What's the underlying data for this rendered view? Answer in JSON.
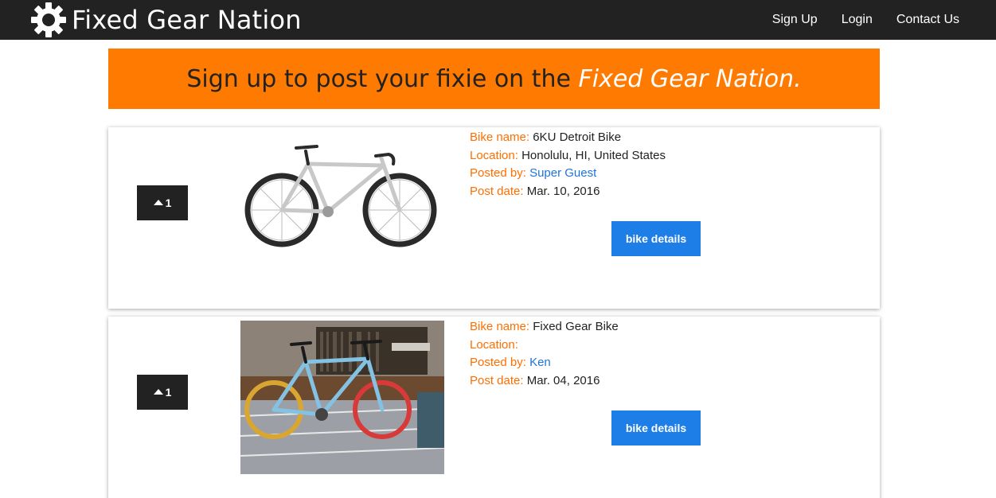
{
  "navbar": {
    "brand": "Fixed Gear Nation",
    "links": [
      "Sign Up",
      "Login",
      "Contact Us"
    ]
  },
  "banner": {
    "prefix": "Sign up to post your fixie on the ",
    "emphasis": "Fixed Gear Nation."
  },
  "labels": {
    "bike_name": "Bike name:",
    "location": "Location:",
    "posted_by": "Posted by:",
    "post_date": "Post date:"
  },
  "bikes": [
    {
      "votes": "1",
      "name": "6KU Detroit Bike",
      "location": "Honolulu, HI, United States",
      "posted_by": "Super Guest",
      "post_date": "Mar. 10, 2016",
      "details_label": "bike details"
    },
    {
      "votes": "1",
      "name": "Fixed Gear Bike",
      "location": "",
      "posted_by": "Ken",
      "post_date": "Mar. 04, 2016",
      "details_label": "bike details"
    }
  ],
  "colors": {
    "navbar": "#222222",
    "banner": "#ff7a00",
    "label_orange": "#ff6e00",
    "link_blue": "#1f73d8",
    "button_blue": "#1e7ee8"
  }
}
